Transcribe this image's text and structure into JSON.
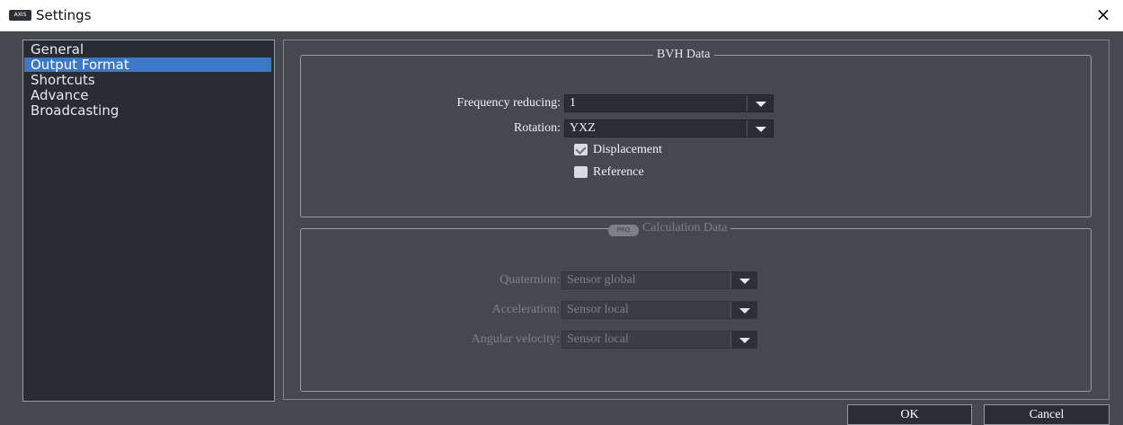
{
  "window": {
    "title": "Settings",
    "logo_text": "AXIS",
    "close_symbol": "×"
  },
  "sidebar": {
    "items": [
      {
        "label": "General",
        "selected": false
      },
      {
        "label": "Output Format",
        "selected": true
      },
      {
        "label": "Shortcuts",
        "selected": false
      },
      {
        "label": "Advance",
        "selected": false
      },
      {
        "label": "Broadcasting",
        "selected": false
      }
    ]
  },
  "bvh": {
    "title": "BVH Data",
    "frequency_label": "Frequency reducing:",
    "frequency_value": "1",
    "rotation_label": "Rotation:",
    "rotation_value": "YXZ",
    "displacement_label": "Displacement",
    "displacement_checked": true,
    "reference_label": "Reference",
    "reference_checked": false
  },
  "calculation": {
    "badge": "PRO",
    "title": "Calculation Data",
    "quaternion_label": "Quaternion:",
    "quaternion_value": "Sensor global",
    "acceleration_label": "Acceleration:",
    "acceleration_value": "Sensor local",
    "angular_label": "Angular velocity:",
    "angular_value": "Sensor local"
  },
  "buttons": {
    "ok": "OK",
    "cancel": "Cancel"
  },
  "colors": {
    "accent": "#3c78c8",
    "background": "#45484f",
    "panel": "#292d33"
  }
}
